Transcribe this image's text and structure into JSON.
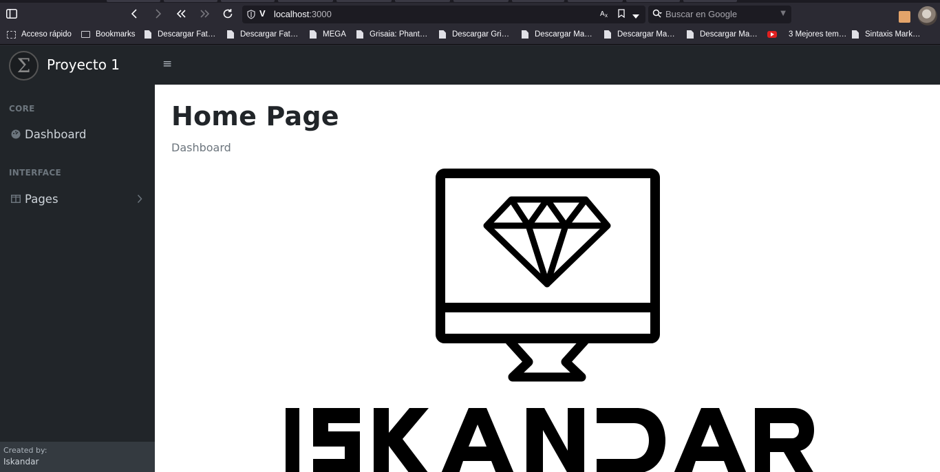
{
  "browser": {
    "url_host": "localhost",
    "url_port": ":3000",
    "search_placeholder": "Buscar en Google",
    "bookmarks": [
      {
        "label": "Acceso rápido",
        "icon": "quick-access-icon"
      },
      {
        "label": "Bookmarks",
        "icon": "folder-icon"
      },
      {
        "label": "Descargar Fat…",
        "icon": "page-icon"
      },
      {
        "label": "Descargar Fat…",
        "icon": "page-icon"
      },
      {
        "label": "MEGA",
        "icon": "page-icon"
      },
      {
        "label": "Grisaia: Phant…",
        "icon": "page-icon"
      },
      {
        "label": "Descargar Gri…",
        "icon": "page-icon"
      },
      {
        "label": "Descargar Ma…",
        "icon": "page-icon"
      },
      {
        "label": "Descargar Ma…",
        "icon": "page-icon"
      },
      {
        "label": "Descargar Ma…",
        "icon": "page-icon"
      },
      {
        "label": "3 Mejores tem…",
        "icon": "youtube-icon"
      },
      {
        "label": "Sintaxis Mark…",
        "icon": "page-icon"
      }
    ]
  },
  "app": {
    "brand": {
      "logo_glyph": "Σ",
      "name": "Proyecto 1"
    },
    "menu_toggle_glyph": "≡",
    "sidebar": {
      "core_heading": "CORE",
      "dashboard_label": "Dashboard",
      "interface_heading": "INTERFACE",
      "pages_label": "Pages",
      "footer_small": "Created by:",
      "footer_name": "Iskandar"
    },
    "main": {
      "title": "Home Page",
      "breadcrumb": "Dashboard",
      "hero_wordmark": "ISKANDAR"
    }
  },
  "colors": {
    "sidebar_bg": "#212529",
    "sidebar_footer_bg": "#343a40",
    "content_bg": "#ffffff",
    "title_text": "#212529",
    "muted_text": "#6c757d"
  }
}
